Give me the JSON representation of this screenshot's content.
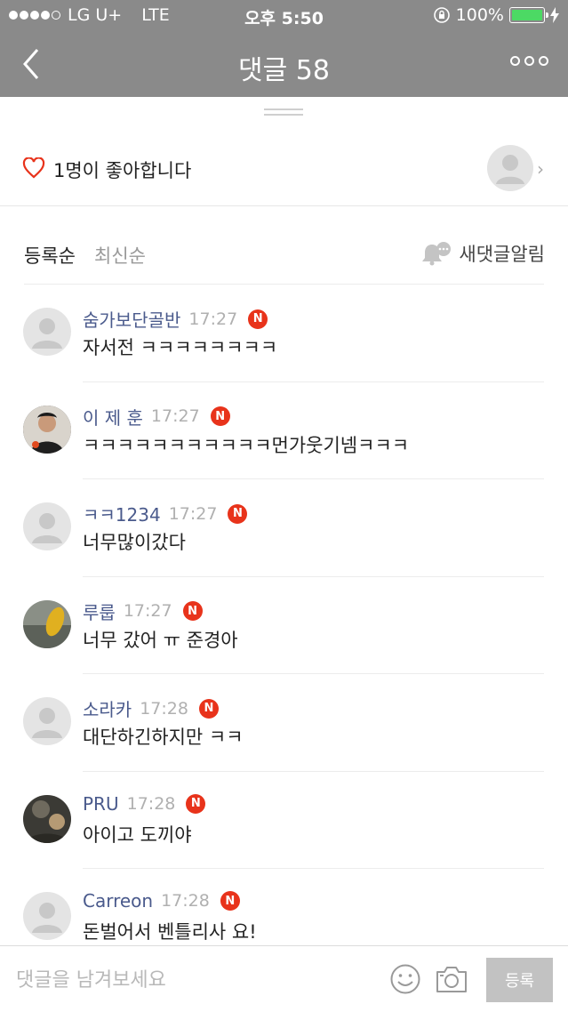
{
  "status_bar": {
    "carrier": "LG U+",
    "network": "LTE",
    "time": "오후 5:50",
    "battery": "100%"
  },
  "header": {
    "title": "댓글 58"
  },
  "likes": {
    "text": "1명이 좋아합니다"
  },
  "sort": {
    "active_tab": "등록순",
    "inactive_tab": "최신순",
    "notify_label": "새댓글알림"
  },
  "comments": [
    {
      "nickname": "숨가보단골반",
      "time": "17:27",
      "badge": "N",
      "text": "자서전 ㅋㅋㅋㅋㅋㅋㅋㅋ"
    },
    {
      "nickname": "이 제 훈",
      "time": "17:27",
      "badge": "N",
      "text": "ㅋㅋㅋㅋㅋㅋㅋㅋㅋㅋㅋ먼가웃기넴ㅋㅋㅋ"
    },
    {
      "nickname": "ㅋㅋ1234",
      "time": "17:27",
      "badge": "N",
      "text": "너무많이갔다"
    },
    {
      "nickname": "루룹",
      "time": "17:27",
      "badge": "N",
      "text": "너무 갔어 ㅠ 준경아"
    },
    {
      "nickname": "소라카",
      "time": "17:28",
      "badge": "N",
      "text": "대단하긴하지만 ㅋㅋ"
    },
    {
      "nickname": "PRU",
      "time": "17:28",
      "badge": "N",
      "text": "아이고 도끼야"
    },
    {
      "nickname": "Carreon",
      "time": "17:28",
      "badge": "N",
      "text": "돈벌어서 벤틀리사 요!"
    }
  ],
  "input": {
    "placeholder": "댓글을 남겨보세요",
    "value": "",
    "submit_label": "등록"
  },
  "colors": {
    "header_bg": "#8a8a8a",
    "nickname": "#4a5a8c",
    "badge": "#e8331b",
    "heart": "#e8331b",
    "battery": "#4cd964"
  },
  "icons": [
    "back-icon",
    "more-icon",
    "heart-icon",
    "bell-icon",
    "emoji-icon",
    "camera-icon",
    "chevron-right-icon"
  ]
}
